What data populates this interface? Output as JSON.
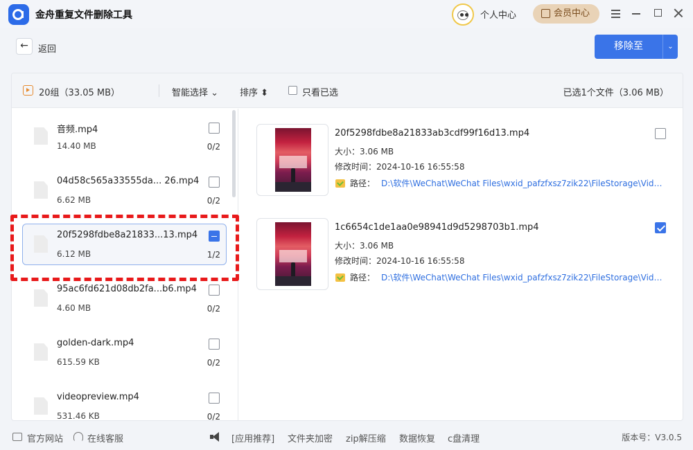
{
  "app": {
    "title": "金舟重复文件删除工具"
  },
  "topbar": {
    "user_center": "个人中心",
    "vip_label": "会员中心"
  },
  "toolbar": {
    "back_label": "返回",
    "back_glyph": "←",
    "move_label": "移除至",
    "move_dropdown_glyph": "⌄"
  },
  "header": {
    "group_label": "20组（33.05 MB）",
    "smart_select": "智能选择 ⌄",
    "sort_label": "排序 ⬍",
    "only_selected": "只看已选",
    "selected_count": "已选1个文件（3.06 MB）"
  },
  "groups": [
    {
      "name": "音频.mp4",
      "size": "14.40 MB",
      "count": "0/2",
      "state": "unchecked"
    },
    {
      "name": "04d58c565a33555da... 26.mp4",
      "size": "6.62 MB",
      "count": "0/2",
      "state": "unchecked"
    },
    {
      "name": "20f5298fdbe8a21833...13.mp4",
      "size": "6.12 MB",
      "count": "1/2",
      "state": "partial"
    },
    {
      "name": "95ac6fd621d08db2fa...b6.mp4",
      "size": "4.60 MB",
      "count": "0/2",
      "state": "unchecked"
    },
    {
      "name": "golden-dark.mp4",
      "size": "615.59 KB",
      "count": "0/2",
      "state": "unchecked"
    },
    {
      "name": "videopreview.mp4",
      "size": "531.46 KB",
      "count": "0/2",
      "state": "unchecked"
    }
  ],
  "details": [
    {
      "name": "20f5298fdbe8a21833ab3cdf99f16d13.mp4",
      "size": "大小：3.06 MB",
      "mtime": "修改时间：2024-10-16 16:55:58",
      "path_label": "路径：",
      "path": "D:\\软件\\WeChat\\WeChat Files\\wxid_pafzfxsz7zik22\\FileStorage\\Video...",
      "checked": false
    },
    {
      "name": "1c6654c1de1aa0e98941d9d5298703b1.mp4",
      "size": "大小：3.06 MB",
      "mtime": "修改时间：2024-10-16 16:55:58",
      "path_label": "路径：",
      "path": "D:\\软件\\WeChat\\WeChat Files\\wxid_pafzfxsz7zik22\\FileStorage\\Video...",
      "checked": true
    }
  ],
  "footer": {
    "website": "官方网站",
    "service": "在线客服",
    "app_recommend": "[应用推荐]",
    "links": [
      "文件夹加密",
      "zip解压缩",
      "数据恢复",
      "c盘清理"
    ],
    "version": "版本号：V3.0.5"
  },
  "colors": {
    "accent": "#3a74e8",
    "highlight": "#e8191a",
    "vip": "#e9d3b7",
    "path_link": "#2f6fe0"
  }
}
